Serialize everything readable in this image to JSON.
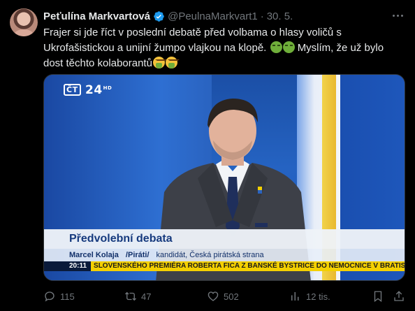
{
  "author": {
    "name": "Peťulína Markvartová",
    "handle": "@PeulnaMarkvart1",
    "date": "30. 5."
  },
  "tweet": {
    "line1": "Frajer si jde říct v poslední debatě před volbama o hlasy voličů s",
    "line2": "Ukrofašistickou a unijní žumpo vlajkou na klopě.",
    "line2b": "Myslím, že už bylo",
    "line3": "dost těchto kolaborantů"
  },
  "media": {
    "channel": "24",
    "channel_suffix": "HD",
    "lower_title": "Předvolební debata",
    "guest_name": "Marcel Kolaja",
    "guest_party": "/Piráti/",
    "guest_role": "kandidát, Česká pirátská strana",
    "ticker_time": "20:11",
    "ticker_text": "SLOVENSKÉHO PREMIÉRA ROBERTA FICA Z BANSKÉ BYSTRICE DO NEMOCNICE V BRATISLAVĚ,"
  },
  "actions": {
    "replies": "115",
    "reposts": "47",
    "likes": "502",
    "views": "12 tis."
  },
  "colors": {
    "background": "#000000",
    "text": "#e7e9ea",
    "muted": "#71767b",
    "verified": "#1d9bf0"
  }
}
